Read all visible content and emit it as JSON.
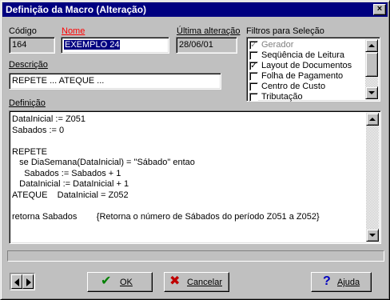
{
  "window": {
    "title": "Definição da Macro (Alteração)",
    "close_label": "×"
  },
  "fields": {
    "codigo": {
      "label": "Código",
      "value": "164"
    },
    "nome": {
      "label": "Nome",
      "value": "EXEMPLO 24",
      "label_color": "#ff0000"
    },
    "ultima_alteracao": {
      "label": "Última alteração",
      "value": "28/06/01"
    },
    "descricao": {
      "label": "Descrição",
      "value": "REPETE ... ATEQUE ..."
    },
    "definicao": {
      "label": "Definição"
    }
  },
  "filtros": {
    "label": "Filtros para Seleção",
    "items": [
      {
        "label": "Gerador",
        "checked": true,
        "disabled": true
      },
      {
        "label": "Seqüência de Leitura",
        "checked": false,
        "disabled": false
      },
      {
        "label": "Layout de Documentos",
        "checked": true,
        "disabled": false
      },
      {
        "label": "Folha de Pagamento",
        "checked": false,
        "disabled": false
      },
      {
        "label": "Centro de Custo",
        "checked": false,
        "disabled": false
      },
      {
        "label": "Tributação",
        "checked": false,
        "disabled": false
      }
    ]
  },
  "code_lines": [
    "DataInicial := Z051",
    "Sabados := 0",
    "",
    "REPETE",
    "   se DiaSemana(DataInicial) = \"Sábado\" entao",
    "     Sabados := Sabados + 1",
    "   DataInicial := DataInicial + 1",
    "ATEQUE    DataInicial = Z052",
    "",
    "retorna Sabados        {Retorna o número de Sábados do período Z051 a Z052}"
  ],
  "buttons": {
    "ok": {
      "label": "OK",
      "icon": "check-icon",
      "color": "#008000"
    },
    "cancelar": {
      "label": "Cancelar",
      "icon": "x-icon",
      "color": "#c00000"
    },
    "ajuda": {
      "label": "Ajuda",
      "icon": "question-icon",
      "color": "#0000c0"
    }
  },
  "colors": {
    "titlebar": "#000080",
    "face": "#c0c0c0",
    "selection": "#000080"
  }
}
